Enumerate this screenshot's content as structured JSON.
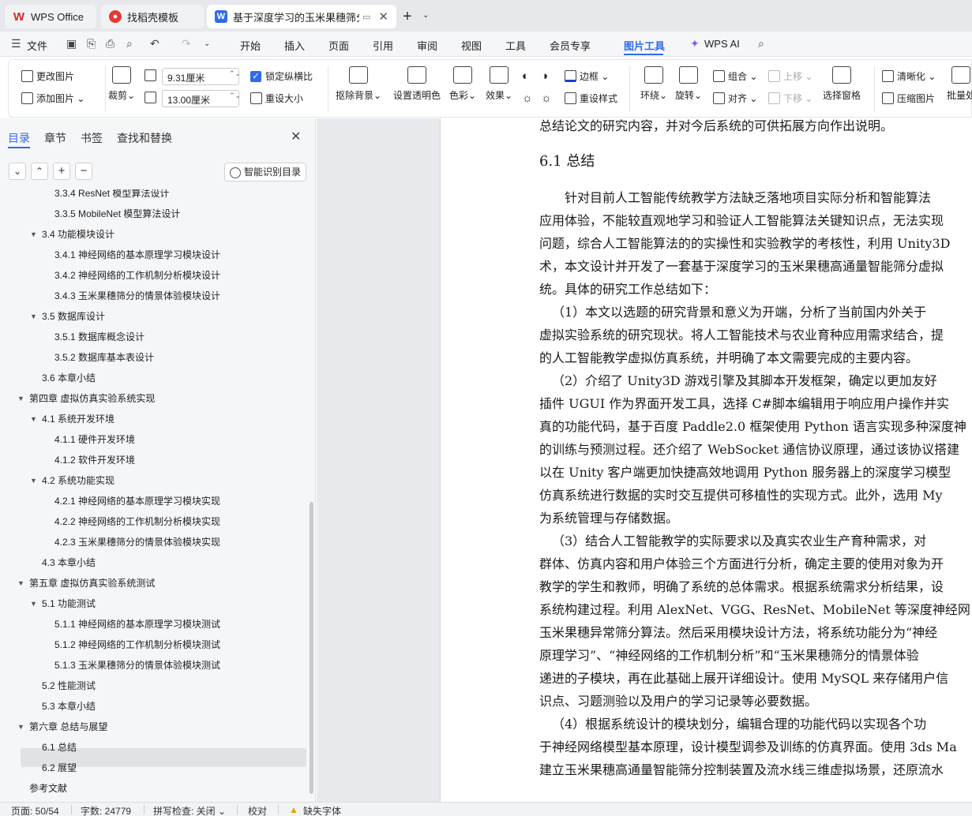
{
  "tabs": {
    "wps": "WPS Office",
    "daoke": "找稻壳模板",
    "doc": "基于深度学习的玉米果穗筛分"
  },
  "menu": [
    "文件",
    "开始",
    "插入",
    "页面",
    "引用",
    "审阅",
    "视图",
    "工具",
    "会员专享",
    "图片工具",
    "WPS AI"
  ],
  "ribbon": {
    "change_pic": "更改图片",
    "add_pic": "添加图片",
    "crop": "裁剪",
    "width": "9.31厘米",
    "height": "13.00厘米",
    "lock_ratio": "锁定纵横比",
    "resize": "重设大小",
    "remove_bg": "抠除背景",
    "transparent": "设置透明色",
    "color": "色彩",
    "effect": "效果",
    "border": "边框",
    "reset_style": "重设样式",
    "wrap": "环绕",
    "rotate": "旋转",
    "group": "组合",
    "align": "对齐",
    "bring_up": "上移",
    "send_down": "下移",
    "select_pane": "选择窗格",
    "sharpen": "清晰化",
    "compress": "压缩图片",
    "batch": "批量处"
  },
  "nav": {
    "tabs": [
      "目录",
      "章节",
      "书签",
      "查找和替换"
    ],
    "smart_toc": "智能识别目录",
    "toc": [
      "3.3.4 ResNet 模型算法设计",
      "3.3.5 MobileNet 模型算法设计",
      "3.4 功能模块设计",
      "3.4.1 神经网络的基本原理学习模块设计",
      "3.4.2 神经网络的工作机制分析模块设计",
      "3.4.3 玉米果穗筛分的情景体验模块设计",
      "3.5 数据库设计",
      "3.5.1 数据库概念设计",
      "3.5.2 数据库基本表设计",
      "3.6 本章小结",
      "第四章  虚拟仿真实验系统实现",
      "4.1 系统开发环境",
      "4.1.1 硬件开发环境",
      "4.1.2 软件开发环境",
      "4.2 系统功能实现",
      "4.2.1 神经网络的基本原理学习模块实现",
      "4.2.2 神经网络的工作机制分析模块实现",
      "4.2.3 玉米果穗筛分的情景体验模块实现",
      "4.3 本章小结",
      "第五章  虚拟仿真实验系统测试",
      "5.1 功能测试",
      "5.1.1 神经网络的基本原理学习模块测试",
      "5.1.2 神经网络的工作机制分析模块测试",
      "5.1.3 玉米果穗筛分的情景体验模块测试",
      "5.2 性能测试",
      "5.3 本章小结",
      "第六章  总结与展望",
      "6.1 总结",
      "6.2 展望",
      "参考文献"
    ]
  },
  "doc": {
    "heading": "6.1 总结",
    "lines": [
      "总结论文的研究内容，并对今后系统的可供拓展方向作出说明。",
      "针对目前人工智能传统教学方法缺乏落地项目实际分析和智能算法",
      "应用体验，不能较直观地学习和验证人工智能算法关键知识点，无法实现",
      "问题，综合人工智能算法的的实操性和实验教学的考核性，利用 Unity3D",
      "术，本文设计并开发了一套基于深度学习的玉米果穗高通量智能筛分虚拟",
      "统。具体的研究工作总结如下：",
      "（1）本文以选题的研究背景和意义为开端，分析了当前国内外关于",
      "虚拟实验系统的研究现状。将人工智能技术与农业育种应用需求结合，提",
      "的人工智能教学虚拟仿真系统，并明确了本文需要完成的主要内容。",
      "（2）介绍了 Unity3D 游戏引擎及其脚本开发框架，确定以更加友好",
      "插件 UGUI 作为界面开发工具，选择 C#脚本编辑用于响应用户操作并实",
      "真的功能代码，基于百度 Paddle2.0 框架使用 Python 语言实现多种深度神",
      "的训练与预测过程。还介绍了 WebSocket 通信协议原理，通过该协议搭建",
      "以在 Unity 客户端更加快捷高效地调用 Python 服务器上的深度学习模型",
      "仿真系统进行数据的实时交互提供可移植性的实现方式。此外，选用 My",
      "为系统管理与存储数据。",
      "（3）结合人工智能教学的实际要求以及真实农业生产育种需求，对",
      "群体、仿真内容和用户体验三个方面进行分析，确定主要的使用对象为开",
      "教学的学生和教师，明确了系统的总体需求。根据系统需求分析结果，设",
      "系统构建过程。利用 AlexNet、VGG、ResNet、MobileNet 等深度神经网",
      "玉米果穗异常筛分算法。然后采用模块设计方法，将系统功能分为“神经",
      "原理学习”、“神经网络的工作机制分析”和“玉米果穗筛分的情景体验",
      "递进的子模块，再在此基础上展开详细设计。使用 MySQL 来存储用户信",
      "识点、习题测验以及用户的学习记录等必要数据。",
      "（4）根据系统设计的模块划分，编辑合理的功能代码以实现各个功",
      "于神经网络模型基本原理，设计模型调参及训练的仿真界面。使用 3ds Ma",
      "建立玉米果穗高通量智能筛分控制装置及流水线三维虚拟场景，还原流水"
    ]
  },
  "status": {
    "page": "页面: 50/54",
    "words": "字数: 24779",
    "spell": "拼写检查: 关闭",
    "proof": "校对",
    "font_warn": "缺失字体"
  },
  "colors": {
    "accent": "#2f6bea",
    "wps_red": "#e0242c"
  }
}
